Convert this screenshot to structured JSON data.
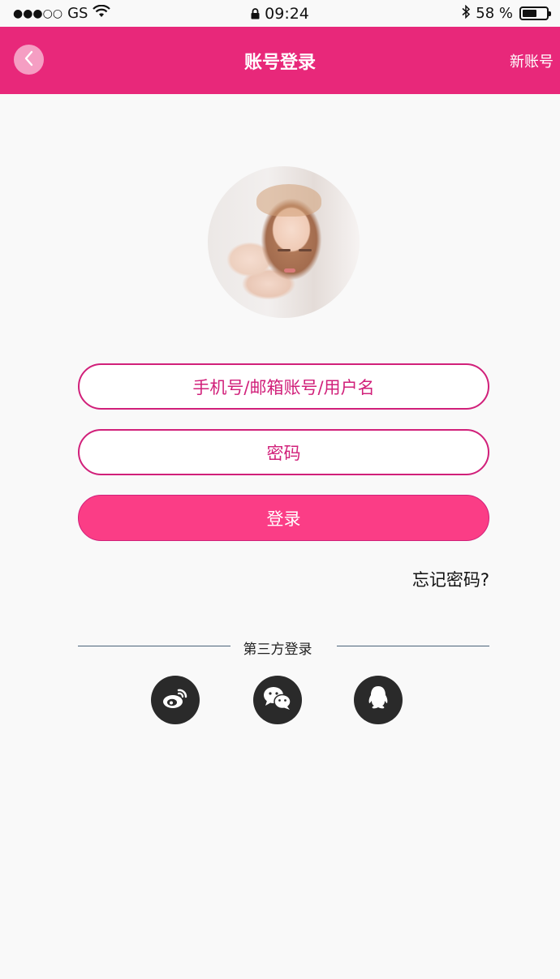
{
  "status_bar": {
    "signal_dots": "●●●○○",
    "carrier": "GS",
    "time": "09:24",
    "battery_percent": "58 %",
    "icons": [
      "wifi-icon",
      "lock-icon",
      "bluetooth-icon",
      "battery-icon"
    ],
    "battery_level": 0.58
  },
  "header": {
    "title": "账号登录",
    "right_action": "新账号",
    "back_icon": "chevron-left-icon",
    "background": "#e8287a"
  },
  "form": {
    "username_placeholder": "手机号/邮箱账号/用户名",
    "password_placeholder": "密码",
    "login_label": "登录",
    "forgot_label": "忘记密码?",
    "accent": "#d1207a",
    "button_color": "#fb3d86"
  },
  "third_party": {
    "label": "第三方登录",
    "providers": [
      "weibo-icon",
      "wechat-icon",
      "qq-icon"
    ]
  }
}
